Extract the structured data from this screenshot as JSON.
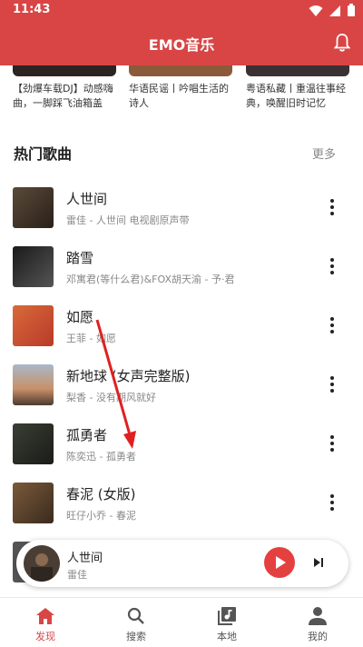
{
  "status_bar": {
    "time": "11:43"
  },
  "header": {
    "title": "EMO音乐"
  },
  "banners": [
    {
      "text": "【劲爆车载DJ】动感嗨曲，一脚踩飞油箱盖"
    },
    {
      "text": "华语民谣丨吟唱生活的诗人"
    },
    {
      "text": "粤语私藏丨重温往事经典，唤醒旧时记忆"
    }
  ],
  "section": {
    "title": "热门歌曲",
    "more": "更多"
  },
  "songs": [
    {
      "title": "人世间",
      "subtitle": "雷佳 - 人世间 电视剧原声带"
    },
    {
      "title": "踏雪",
      "subtitle": "邓寓君(等什么君)&FOX胡天渝 - 予·君"
    },
    {
      "title": "如愿",
      "subtitle": "王菲 - 如愿"
    },
    {
      "title": "新地球 (女声完整版)",
      "subtitle": "梨香 - 没有期风就好"
    },
    {
      "title": "孤勇者",
      "subtitle": "陈奕迅 - 孤勇者"
    },
    {
      "title": "春泥 (女版)",
      "subtitle": "旺仔小乔 - 春泥"
    }
  ],
  "player": {
    "title": "人世间",
    "artist": "雷佳"
  },
  "nav": [
    {
      "label": "发现"
    },
    {
      "label": "搜索"
    },
    {
      "label": "本地"
    },
    {
      "label": "我的"
    }
  ],
  "colors": {
    "brand": "#d94545",
    "play": "#e54040"
  }
}
